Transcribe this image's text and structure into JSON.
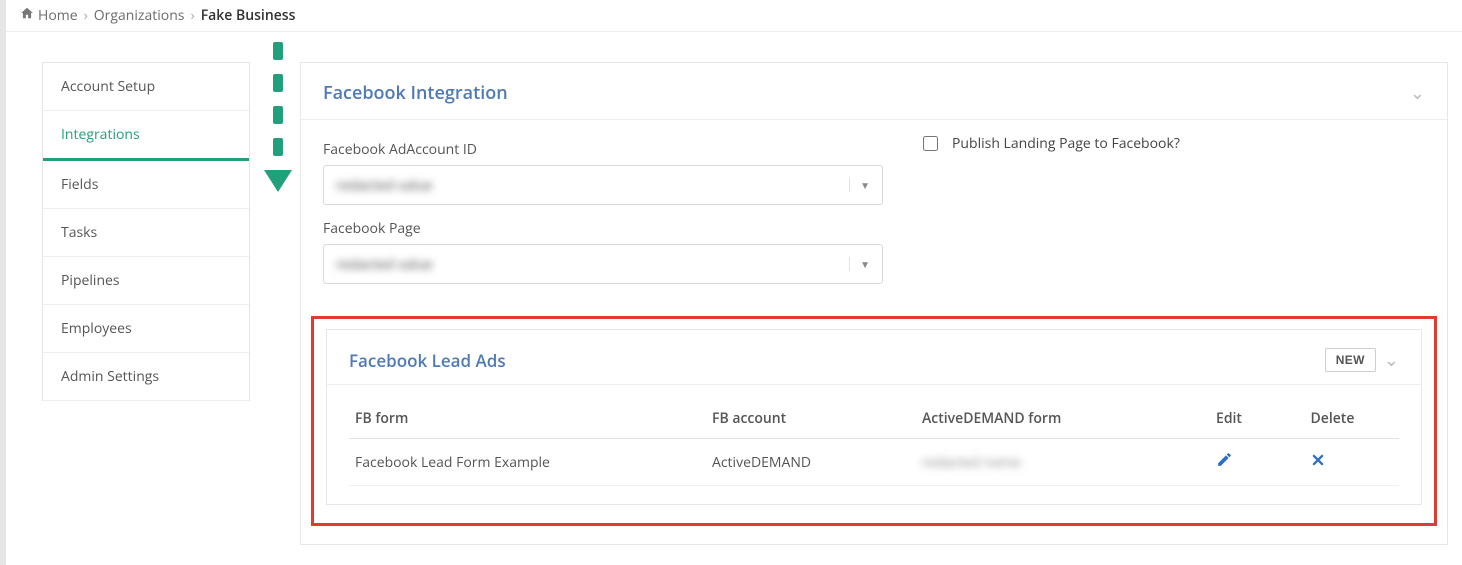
{
  "breadcrumb": {
    "home": "Home",
    "organizations": "Organizations",
    "current": "Fake Business"
  },
  "sidebar": {
    "items": [
      {
        "label": "Account Setup"
      },
      {
        "label": "Integrations"
      },
      {
        "label": "Fields"
      },
      {
        "label": "Tasks"
      },
      {
        "label": "Pipelines"
      },
      {
        "label": "Employees"
      },
      {
        "label": "Admin Settings"
      }
    ],
    "active_index": 1
  },
  "integration_panel": {
    "title": "Facebook Integration",
    "adaccount_label": "Facebook AdAccount ID",
    "adaccount_value": "redacted value",
    "page_label": "Facebook Page",
    "page_value": "redacted value",
    "publish_checkbox_label": "Publish Landing Page to Facebook?",
    "publish_checked": false
  },
  "leadads_panel": {
    "title": "Facebook Lead Ads",
    "new_button": "NEW",
    "columns": {
      "fb_form": "FB form",
      "fb_account": "FB account",
      "ad_form": "ActiveDEMAND form",
      "edit": "Edit",
      "delete": "Delete"
    },
    "rows": [
      {
        "fb_form": "Facebook Lead Form Example",
        "fb_account": "ActiveDEMAND",
        "ad_form": "redacted name"
      }
    ]
  }
}
